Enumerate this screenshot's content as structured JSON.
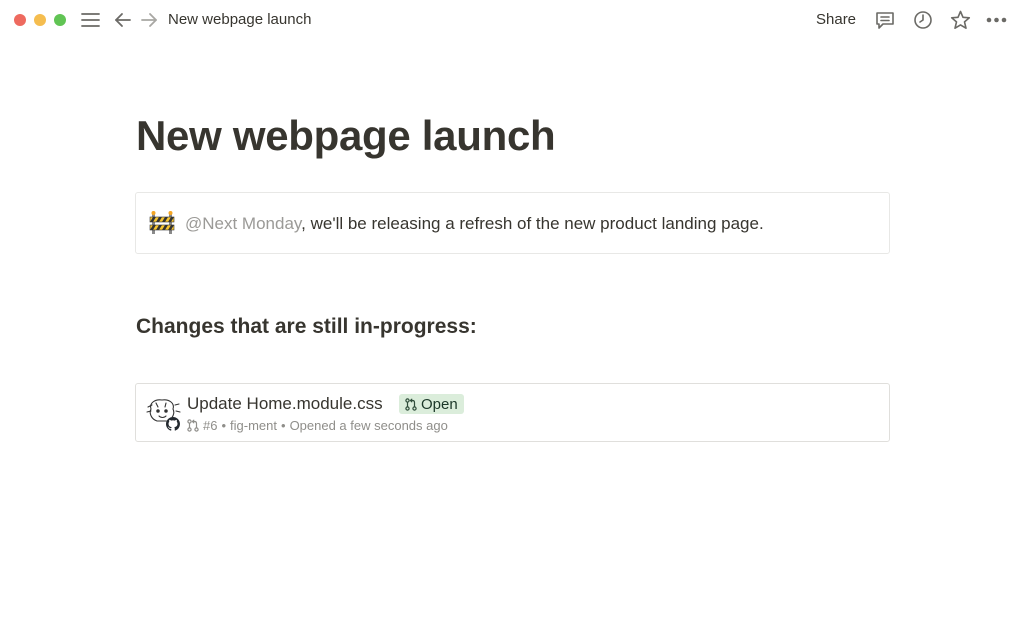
{
  "window": {
    "breadcrumb": "New webpage launch",
    "share_label": "Share"
  },
  "icons": {
    "menu": "hamburger-icon",
    "back": "arrow-left-icon",
    "forward": "arrow-right-icon",
    "comments": "comment-icon",
    "updates": "clock-icon",
    "favorite": "star-icon",
    "more": "more-horizontal-icon"
  },
  "page": {
    "title": "New webpage launch",
    "callout": {
      "mention": "@Next Monday",
      "text": ", we'll be releasing a refresh of the new product landing page."
    },
    "heading": "Changes that are still in-progress:",
    "pull_request": {
      "title": "Update Home.module.css",
      "status": "Open",
      "number": "#6",
      "repo": "fig-ment",
      "opened": "Opened a few seconds ago",
      "separator": "•"
    }
  },
  "colors": {
    "text": "#37352f",
    "muted": "#9b9a97",
    "badge_bg": "#dbeddb",
    "traffic_red": "#ee6a5f",
    "traffic_yellow": "#f5bd4f",
    "traffic_green": "#61c454"
  }
}
